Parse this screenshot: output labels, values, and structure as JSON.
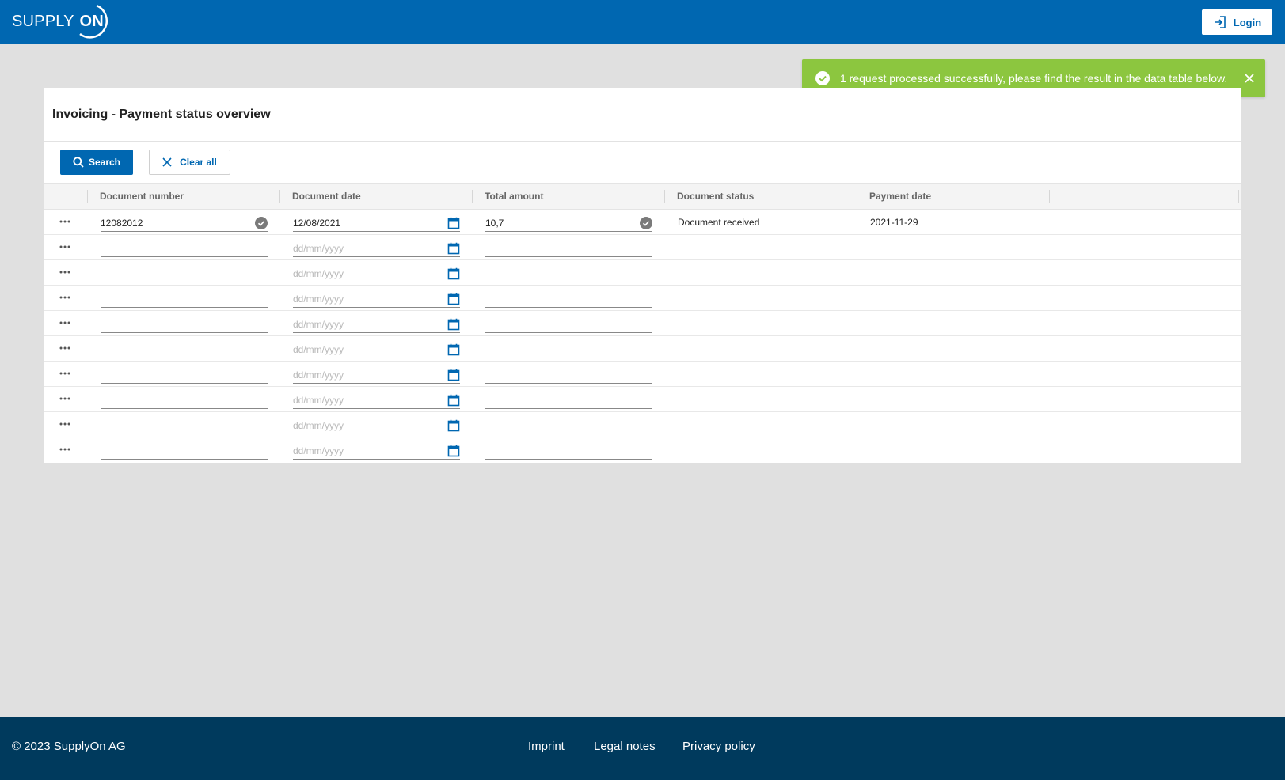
{
  "header": {
    "logo_supply": "SUPPLY",
    "logo_on": "ON",
    "login_label": "Login"
  },
  "toast": {
    "message": "1 request processed successfully, please find the result in the data table below."
  },
  "page": {
    "title": "Invoicing - Payment status overview",
    "search_label": "Search",
    "clear_label": "Clear all"
  },
  "table": {
    "columns": [
      "Document number",
      "Document date",
      "Total amount",
      "Document status",
      "Payment date"
    ],
    "date_placeholder": "dd/mm/yyyy",
    "rows": [
      {
        "document_number": "12082012",
        "document_date": "12/08/2021",
        "total_amount": "10,7",
        "document_status": "Document received",
        "payment_date": "2021-11-29"
      },
      {
        "document_number": "",
        "document_date": "",
        "total_amount": "",
        "document_status": "",
        "payment_date": ""
      },
      {
        "document_number": "",
        "document_date": "",
        "total_amount": "",
        "document_status": "",
        "payment_date": ""
      },
      {
        "document_number": "",
        "document_date": "",
        "total_amount": "",
        "document_status": "",
        "payment_date": ""
      },
      {
        "document_number": "",
        "document_date": "",
        "total_amount": "",
        "document_status": "",
        "payment_date": ""
      },
      {
        "document_number": "",
        "document_date": "",
        "total_amount": "",
        "document_status": "",
        "payment_date": ""
      },
      {
        "document_number": "",
        "document_date": "",
        "total_amount": "",
        "document_status": "",
        "payment_date": ""
      },
      {
        "document_number": "",
        "document_date": "",
        "total_amount": "",
        "document_status": "",
        "payment_date": ""
      },
      {
        "document_number": "",
        "document_date": "",
        "total_amount": "",
        "document_status": "",
        "payment_date": ""
      },
      {
        "document_number": "",
        "document_date": "",
        "total_amount": "",
        "document_status": "",
        "payment_date": ""
      }
    ]
  },
  "footer": {
    "copyright": "© 2023 SupplyOn AG",
    "links": [
      "Imprint",
      "Legal notes",
      "Privacy policy"
    ]
  },
  "colors": {
    "brand_blue": "#0067b1",
    "success_green": "#8cc63f",
    "footer_navy": "#003a5d",
    "background": "#e0e0e0"
  },
  "icons": {
    "login": "login-icon",
    "toast_ok": "check-circle-icon",
    "toast_close": "close-icon",
    "search": "search-icon",
    "clear": "close-icon",
    "row_menu": "more-horizontal-icon",
    "valid": "check-circle-icon",
    "calendar": "calendar-icon"
  }
}
